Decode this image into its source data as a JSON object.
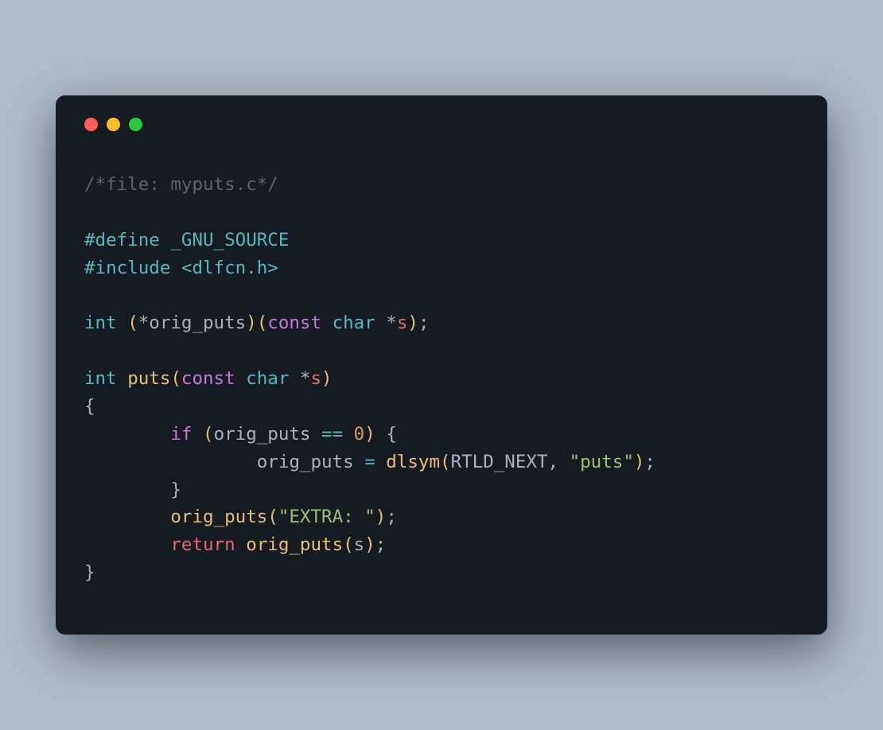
{
  "colors": {
    "background": "#aebdcb",
    "window": "#161a21",
    "traffic_red": "#ff5f56",
    "traffic_yellow": "#ffbd2e",
    "traffic_green": "#27c93f"
  },
  "code": {
    "lines": [
      [
        {
          "cls": "tok-comment",
          "text": "/*file: myputs.c*/"
        }
      ],
      [
        {
          "cls": "",
          "text": ""
        }
      ],
      [
        {
          "cls": "tok-preproc",
          "text": "#define _GNU_SOURCE"
        }
      ],
      [
        {
          "cls": "tok-preproc",
          "text": "#include <dlfcn.h>"
        }
      ],
      [
        {
          "cls": "",
          "text": ""
        }
      ],
      [
        {
          "cls": "tok-type",
          "text": "int"
        },
        {
          "cls": "tok-ident",
          "text": " "
        },
        {
          "cls": "tok-paren",
          "text": "("
        },
        {
          "cls": "tok-ident",
          "text": "*orig_puts"
        },
        {
          "cls": "tok-paren",
          "text": ")("
        },
        {
          "cls": "tok-keyword",
          "text": "const"
        },
        {
          "cls": "tok-ident",
          "text": " "
        },
        {
          "cls": "tok-type",
          "text": "char"
        },
        {
          "cls": "tok-ident",
          "text": " *"
        },
        {
          "cls": "tok-ident2",
          "text": "s"
        },
        {
          "cls": "tok-paren",
          "text": ")"
        },
        {
          "cls": "tok-punct",
          "text": ";"
        }
      ],
      [
        {
          "cls": "",
          "text": ""
        }
      ],
      [
        {
          "cls": "tok-type",
          "text": "int"
        },
        {
          "cls": "tok-ident",
          "text": " "
        },
        {
          "cls": "tok-func",
          "text": "puts"
        },
        {
          "cls": "tok-paren",
          "text": "("
        },
        {
          "cls": "tok-keyword",
          "text": "const"
        },
        {
          "cls": "tok-ident",
          "text": " "
        },
        {
          "cls": "tok-type",
          "text": "char"
        },
        {
          "cls": "tok-ident",
          "text": " *"
        },
        {
          "cls": "tok-ident2",
          "text": "s"
        },
        {
          "cls": "tok-paren",
          "text": ")"
        }
      ],
      [
        {
          "cls": "tok-punct",
          "text": "{"
        }
      ],
      [
        {
          "cls": "tok-ident",
          "text": "        "
        },
        {
          "cls": "tok-keyword",
          "text": "if"
        },
        {
          "cls": "tok-ident",
          "text": " "
        },
        {
          "cls": "tok-paren",
          "text": "("
        },
        {
          "cls": "tok-ident",
          "text": "orig_puts "
        },
        {
          "cls": "tok-op",
          "text": "=="
        },
        {
          "cls": "tok-ident",
          "text": " "
        },
        {
          "cls": "tok-number",
          "text": "0"
        },
        {
          "cls": "tok-paren",
          "text": ")"
        },
        {
          "cls": "tok-ident",
          "text": " "
        },
        {
          "cls": "tok-punct",
          "text": "{"
        }
      ],
      [
        {
          "cls": "tok-ident",
          "text": "                orig_puts "
        },
        {
          "cls": "tok-op",
          "text": "="
        },
        {
          "cls": "tok-ident",
          "text": " "
        },
        {
          "cls": "tok-func",
          "text": "dlsym"
        },
        {
          "cls": "tok-paren",
          "text": "("
        },
        {
          "cls": "tok-ident",
          "text": "RTLD_NEXT, "
        },
        {
          "cls": "tok-string",
          "text": "\"puts\""
        },
        {
          "cls": "tok-paren",
          "text": ")"
        },
        {
          "cls": "tok-punct",
          "text": ";"
        }
      ],
      [
        {
          "cls": "tok-ident",
          "text": "        "
        },
        {
          "cls": "tok-punct",
          "text": "}"
        }
      ],
      [
        {
          "cls": "tok-ident",
          "text": "        "
        },
        {
          "cls": "tok-func",
          "text": "orig_puts"
        },
        {
          "cls": "tok-paren",
          "text": "("
        },
        {
          "cls": "tok-string",
          "text": "\"EXTRA: \""
        },
        {
          "cls": "tok-paren",
          "text": ")"
        },
        {
          "cls": "tok-punct",
          "text": ";"
        }
      ],
      [
        {
          "cls": "tok-ident",
          "text": "        "
        },
        {
          "cls": "tok-return",
          "text": "return"
        },
        {
          "cls": "tok-ident",
          "text": " "
        },
        {
          "cls": "tok-func",
          "text": "orig_puts"
        },
        {
          "cls": "tok-paren",
          "text": "("
        },
        {
          "cls": "tok-ident",
          "text": "s"
        },
        {
          "cls": "tok-paren",
          "text": ")"
        },
        {
          "cls": "tok-punct",
          "text": ";"
        }
      ],
      [
        {
          "cls": "tok-punct",
          "text": "}"
        }
      ]
    ]
  }
}
